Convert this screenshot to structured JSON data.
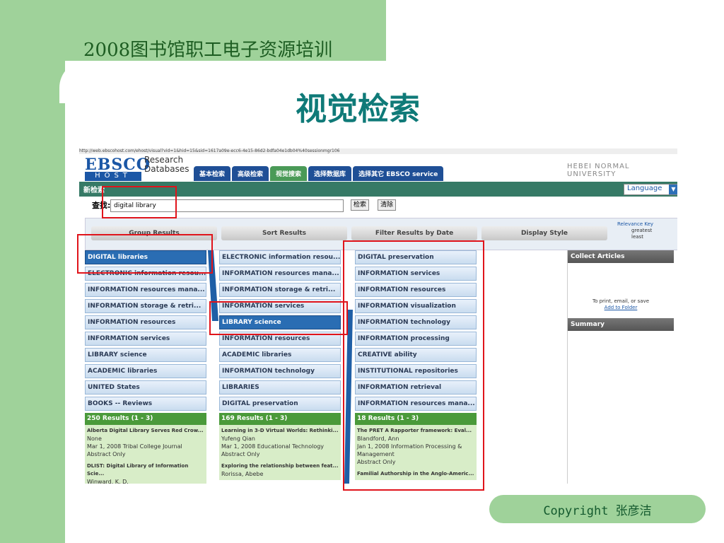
{
  "slide": {
    "header_title": "2008图书馆职工电子资源培训",
    "main_title": "视觉检索",
    "footer": "Copyright  张彦洁"
  },
  "app": {
    "url": "http://web.ebscohost.com/ehost/visual?vid=1&hid=15&sid=1617a09e-ecc6-4e15-86d2-bdfa04e1db04%40sessionmgr106",
    "logo_top": "EBSCO",
    "logo_bottom": "HOST",
    "logo_side_1": "Research",
    "logo_side_2": "Databases",
    "tabs": [
      "基本检索",
      "高级检索",
      "视觉搜索",
      "选择数据库",
      "选择其它 EBSCO service"
    ],
    "university": "HEBEI NORMAL UNIVERSITY",
    "new_search": "新检索",
    "language": "Language",
    "find_label": "查找:",
    "search_value": "digital library",
    "search_button": "检索",
    "clear_button": "清除",
    "toolbar": [
      "Group Results",
      "Sort Results",
      "Filter Results by Date",
      "Display Style"
    ],
    "relevance_key": [
      "Relevance Key",
      "greatest",
      "least"
    ]
  },
  "columns": [
    {
      "items": [
        "DIGITAL libraries",
        "ELECTRONIC information resou...",
        "INFORMATION resources mana...",
        "INFORMATION storage & retri...",
        "INFORMATION resources",
        "INFORMATION services",
        "LIBRARY science",
        "ACADEMIC libraries",
        "UNITED States",
        "BOOKS -- Reviews"
      ],
      "selected": 0,
      "results": "250 Results (1 - 3)",
      "articles": [
        {
          "title": "Alberta Digital Library Serves Red Crow...",
          "author": "None",
          "source": "Mar 1, 2008 Tribal College Journal",
          "note": "Abstract Only"
        },
        {
          "title": "DLIST: Digital Library of Information Scie...",
          "author": "Winward, K. D.",
          "source": "",
          "note": ""
        }
      ]
    },
    {
      "items": [
        "ELECTRONIC information resou...",
        "INFORMATION resources mana...",
        "INFORMATION storage & retri...",
        "INFORMATION services",
        "LIBRARY science",
        "INFORMATION resources",
        "ACADEMIC libraries",
        "INFORMATION technology",
        "LIBRARIES",
        "DIGITAL preservation"
      ],
      "selected": 4,
      "results": "169 Results (1 - 3)",
      "articles": [
        {
          "title": "Learning in 3-D Virtual Worlds: Rethinki...",
          "author": "Yufeng Qian",
          "source": "Mar 1, 2008 Educational Technology",
          "note": "Abstract Only"
        },
        {
          "title": "Exploring the relationship between feat...",
          "author": "Rorissa, Abebe",
          "source": "",
          "note": ""
        }
      ]
    },
    {
      "items": [
        "DIGITAL preservation",
        "INFORMATION services",
        "INFORMATION resources",
        "INFORMATION visualization",
        "INFORMATION technology",
        "INFORMATION processing",
        "CREATIVE ability",
        "INSTITUTIONAL repositories",
        "INFORMATION retrieval",
        "INFORMATION resources mana..."
      ],
      "selected": -1,
      "results": "18 Results (1 - 3)",
      "articles": [
        {
          "title": "The PRET A Rapporter framework: Eval...",
          "author": "Blandford, Ann",
          "source": "Jan 1, 2008 Information Processing & Management",
          "note": "Abstract Only"
        },
        {
          "title": "Familial Authorship in the Anglo-Americ...",
          "author": "",
          "source": "",
          "note": ""
        }
      ]
    }
  ],
  "sidebar": {
    "collect": "Collect Articles",
    "hint": "To print, email, or save",
    "link": "Add to Folder",
    "summary": "Summary"
  }
}
